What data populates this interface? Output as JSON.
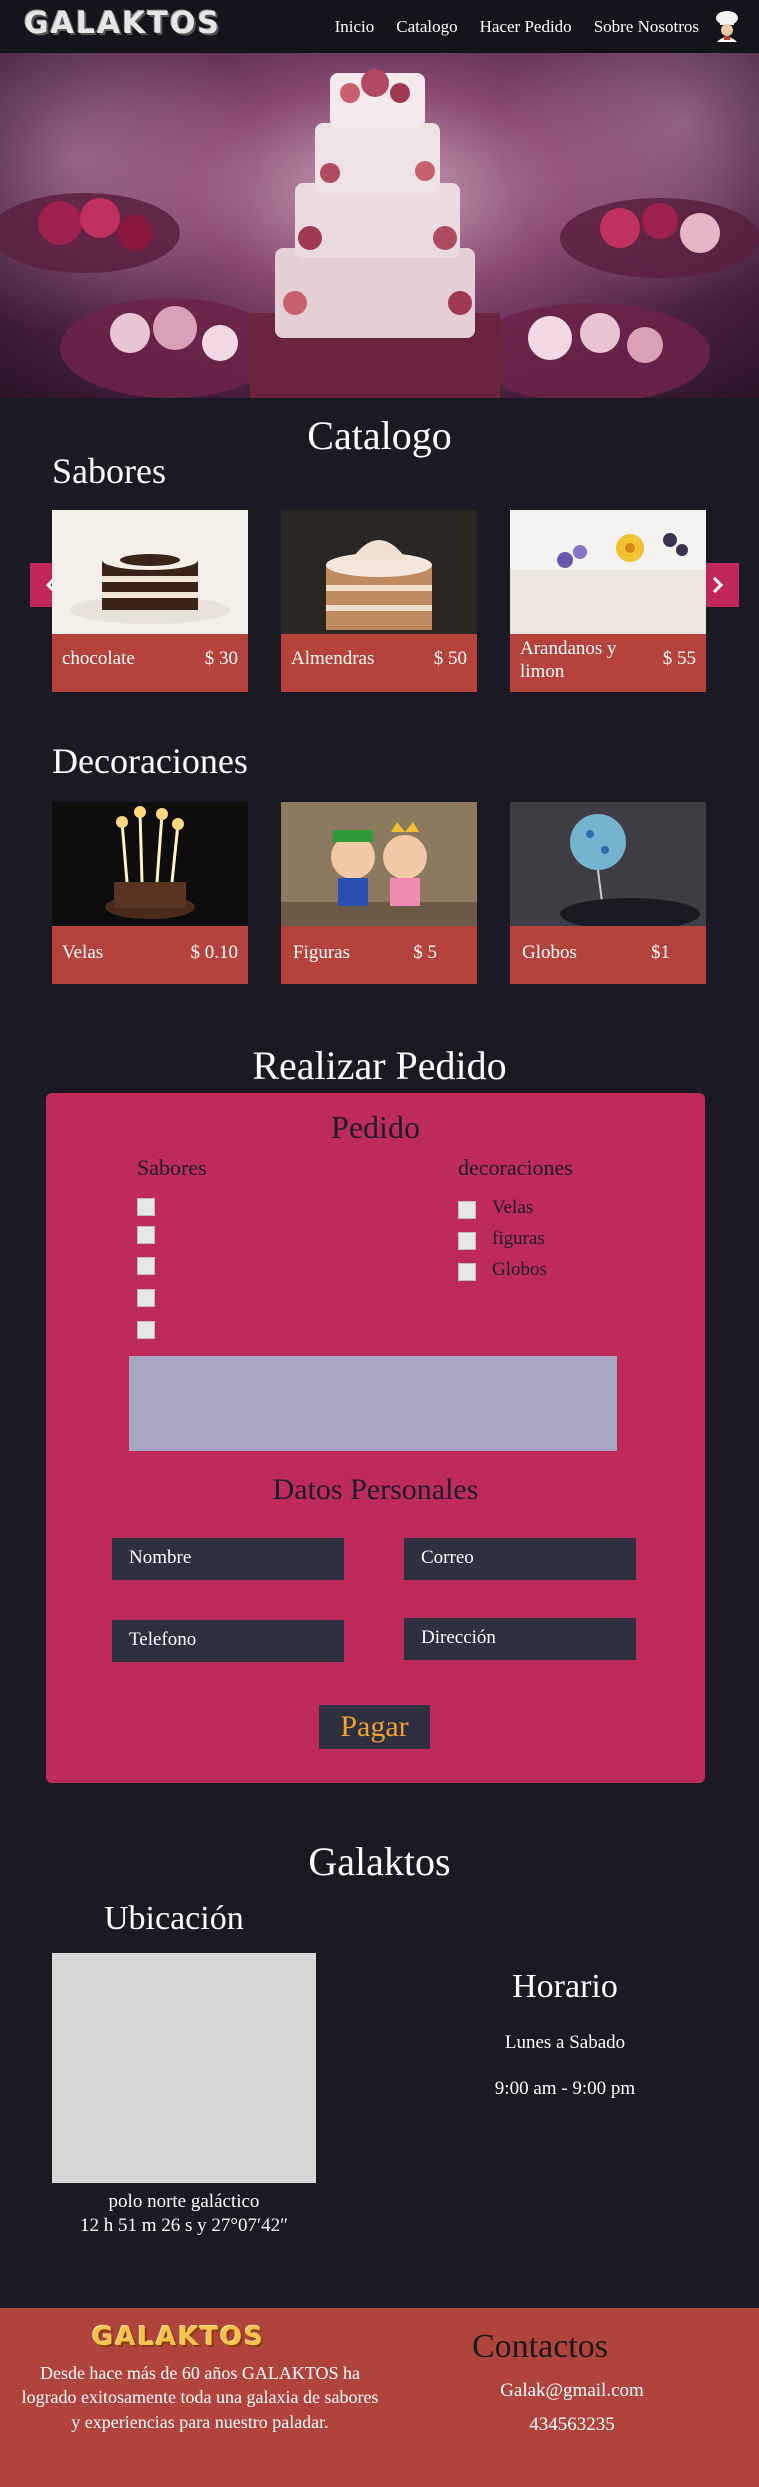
{
  "nav": {
    "logo": "GALAKTOS",
    "links": [
      "Inicio",
      "Catalogo",
      "Hacer Pedido",
      "Sobre Nosotros"
    ]
  },
  "catalog": {
    "title": "Catalogo",
    "flavors_title": "Sabores",
    "flavors": [
      {
        "name": "chocolate",
        "price": "$ 30"
      },
      {
        "name": "Almendras",
        "price": "$ 50"
      },
      {
        "name": "Arandanos y limon",
        "price": "$ 55"
      }
    ],
    "decorations_title": "Decoraciones",
    "decorations": [
      {
        "name": "Velas",
        "price": "$ 0.10"
      },
      {
        "name": "Figuras",
        "price": "$ 5"
      },
      {
        "name": "Globos",
        "price": "$1"
      }
    ]
  },
  "order": {
    "section_title": "Realizar Pedido",
    "panel_title": "Pedido",
    "flavors_label": "Sabores",
    "decorations_label": "decoraciones",
    "decoration_options": [
      "Velas",
      "figuras",
      "Globos"
    ],
    "personal_title": "Datos Personales",
    "fields": {
      "name": "Nombre",
      "email": "Correo",
      "phone": "Telefono",
      "address": "Dirección"
    },
    "pay_button": "Pagar"
  },
  "about": {
    "title": "Galaktos",
    "location_title": "Ubicación",
    "location_text_1": "polo norte galáctico",
    "location_text_2": "12 h 51 m 26 s y 27°07′42″",
    "schedule_title": "Horario",
    "schedule_days": "Lunes a Sabado",
    "schedule_hours": "9:00 am - 9:00 pm"
  },
  "footer": {
    "logo": "GALAKTOS",
    "description": "Desde hace más de 60 años GALAKTOS ha logrado exitosamente toda una galaxia de sabores y experiencias para nuestro paladar.",
    "contact_title": "Contactos",
    "email": "Galak@gmail.com",
    "phone": "434563235"
  },
  "colors": {
    "background": "#1b1a24",
    "card": "#b6423c",
    "panel": "#bf2a5c",
    "accent": "#c1275a",
    "pay_text": "#f0a030"
  }
}
